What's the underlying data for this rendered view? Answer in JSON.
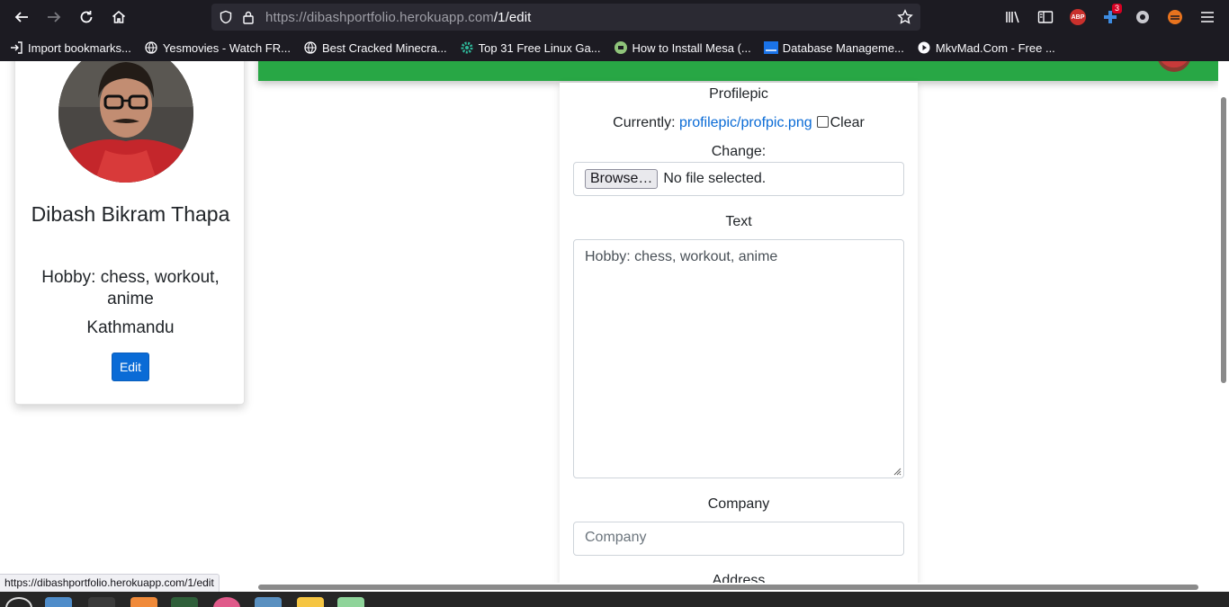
{
  "browser": {
    "url_host": "https://dibashportfolio.herokuapp.com",
    "url_path": "/1/edit",
    "ext_badge": "3",
    "abp_label": "ABP",
    "bookmarks": [
      {
        "label": "Import bookmarks...",
        "icon": "import-icon"
      },
      {
        "label": "Yesmovies - Watch FR...",
        "icon": "globe-icon"
      },
      {
        "label": "Best Cracked Minecra...",
        "icon": "globe-icon"
      },
      {
        "label": "Top 31 Free Linux Ga...",
        "icon": "gear-icon"
      },
      {
        "label": "How to Install Mesa (...",
        "icon": "site-icon"
      },
      {
        "label": "Database Manageme...",
        "icon": "site-icon"
      },
      {
        "label": "MkvMad.Com - Free ...",
        "icon": "play-icon"
      }
    ],
    "status_url": "https://dibashportfolio.herokuapp.com/1/edit"
  },
  "profile": {
    "name": "Dibash Bikram Thapa",
    "hobby": "Hobby: chess, workout, anime",
    "city": "Kathmandu",
    "edit_label": "Edit"
  },
  "form": {
    "profilepic_label": "Profilepic",
    "currently_label": "Currently:",
    "current_file": "profilepic/profpic.png",
    "clear_label": "Clear",
    "change_label": "Change:",
    "browse_label": "Browse…",
    "no_file": "No file selected.",
    "text_label": "Text",
    "text_value": "Hobby: chess, workout, anime",
    "company_label": "Company",
    "company_placeholder": "Company",
    "address_label": "Address"
  }
}
